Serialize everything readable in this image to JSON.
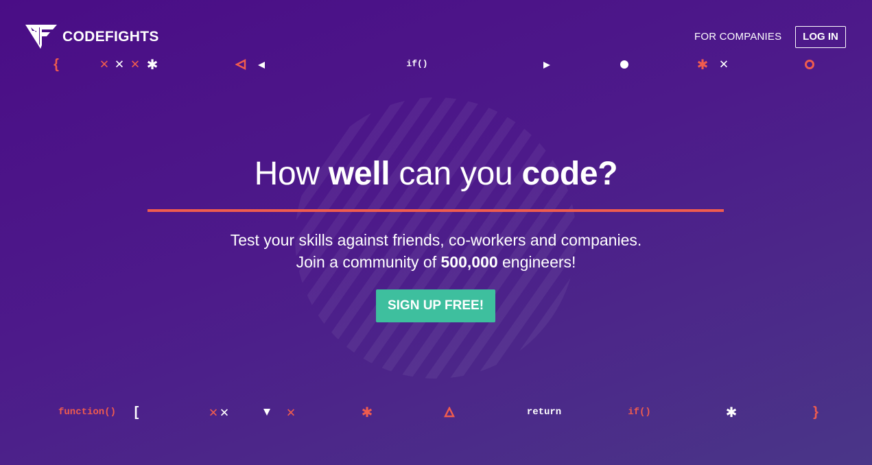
{
  "brand": {
    "name": "CODEFIGHTS"
  },
  "nav": {
    "for_companies": "FOR COMPANIES",
    "login": "LOG IN"
  },
  "hero": {
    "headline_parts": [
      "How ",
      "well",
      " can you ",
      "code?"
    ],
    "subline1": "Test your skills against friends, co-workers and companies.",
    "subline2_pre": "Join a community of ",
    "subline2_count": "500,000",
    "subline2_post": " engineers!",
    "cta": "SIGN UP FREE!"
  },
  "decor_top": {
    "brace": "{",
    "if_call": "if()"
  },
  "decor_bottom": {
    "function_call": "function()",
    "bracket": "[",
    "return_kw": "return",
    "if_call": "if()",
    "brace": "}"
  },
  "colors": {
    "accent": "#f05c4e",
    "cta": "#3ebf9e",
    "bg": "#4a0d86"
  }
}
